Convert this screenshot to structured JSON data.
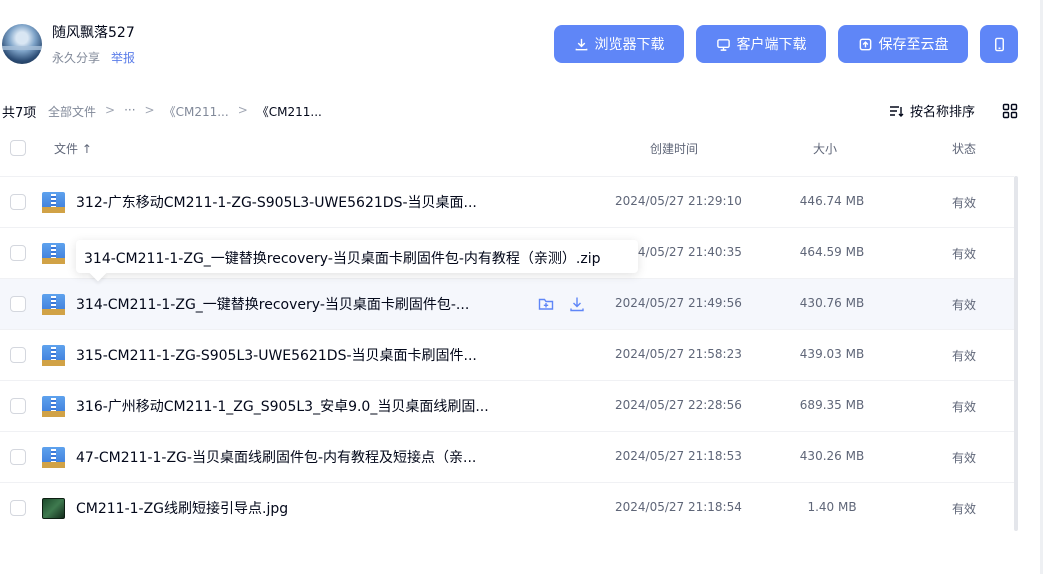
{
  "header": {
    "username": "随风飘落527",
    "share_type": "永久分享",
    "report": "举报",
    "btn_browser": "浏览器下载",
    "btn_client": "客户端下载",
    "btn_save": "保存至云盘"
  },
  "toolbar": {
    "count": "共7项",
    "crumbs": [
      "全部文件",
      "···",
      "《CM211...",
      "《CM211..."
    ],
    "sort": "按名称排序"
  },
  "table": {
    "col_file": "文件 ↑",
    "col_time": "创建时间",
    "col_size": "大小",
    "col_status": "状态"
  },
  "rows": [
    {
      "name": "312-广东移动CM211-1-ZG-S905L3-UWE5621DS-当贝桌面...",
      "time": "2024/05/27 21:29:10",
      "size": "446.74 MB",
      "status": "有效",
      "type": "zip"
    },
    {
      "name": "314-CM211-1-ZG_一键替换recovery-当贝桌面卡刷固件包-内有教程（亲测）.zip",
      "time": "2024/05/27 21:40:35",
      "size": "464.59 MB",
      "status": "有效",
      "type": "zip"
    },
    {
      "name": "314-CM211-1-ZG_一键替换recovery-当贝桌面卡刷固件包-...",
      "time": "2024/05/27 21:49:56",
      "size": "430.76 MB",
      "status": "有效",
      "type": "zip"
    },
    {
      "name": "315-CM211-1-ZG-S905L3-UWE5621DS-当贝桌面卡刷固件...",
      "time": "2024/05/27 21:58:23",
      "size": "439.03 MB",
      "status": "有效",
      "type": "zip"
    },
    {
      "name": "316-广州移动CM211-1_ZG_S905L3_安卓9.0_当贝桌面线刷固...",
      "time": "2024/05/27 22:28:56",
      "size": "689.35 MB",
      "status": "有效",
      "type": "zip"
    },
    {
      "name": "47-CM211-1-ZG-当贝桌面线刷固件包-内有教程及短接点（亲...",
      "time": "2024/05/27 21:18:53",
      "size": "430.26 MB",
      "status": "有效",
      "type": "zip"
    },
    {
      "name": "CM211-1-ZG线刷短接引导点.jpg",
      "time": "2024/05/27 21:18:54",
      "size": "1.40 MB",
      "status": "有效",
      "type": "jpg"
    }
  ],
  "tooltip": "314-CM211-1-ZG_一键替换recovery-当贝桌面卡刷固件包-内有教程（亲测）.zip",
  "colors": {
    "accent": "#5f86f7",
    "link": "#5b7de9",
    "hover_row": "#f5f7fc"
  }
}
